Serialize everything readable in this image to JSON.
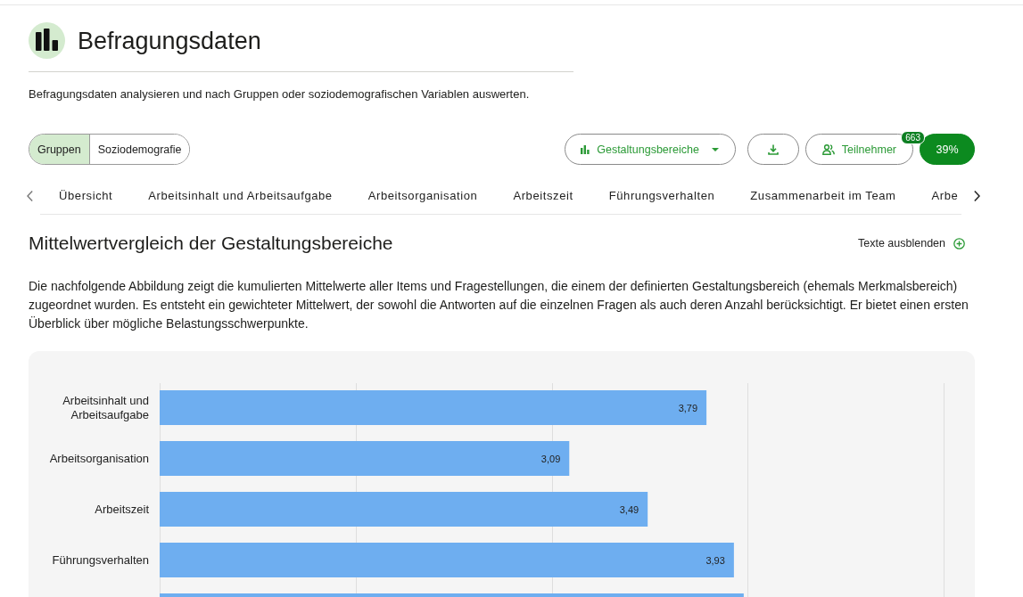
{
  "header": {
    "title": "Befragungsdaten",
    "subtitle": "Befragungsdaten analysieren und nach Gruppen oder soziodemografischen Variablen auswerten."
  },
  "view_toggle": [
    {
      "label": "Gruppen",
      "selected": true
    },
    {
      "label": "Soziodemografie",
      "selected": false
    }
  ],
  "toolbar": {
    "dropdown": {
      "label": "Gestaltungsbereiche"
    },
    "participants": {
      "label": "Teilnehmer",
      "count": "663"
    },
    "response_rate": "39%"
  },
  "tabs": [
    {
      "label": "Übersicht"
    },
    {
      "label": "Arbeitsinhalt und Arbeitsaufgabe"
    },
    {
      "label": "Arbeitsorganisation"
    },
    {
      "label": "Arbeitszeit"
    },
    {
      "label": "Führungsverhalten"
    },
    {
      "label": "Zusammenarbeit im Team"
    },
    {
      "label": "Arbe"
    }
  ],
  "section": {
    "title": "Mittelwertvergleich der Gestaltungsbereiche",
    "toggle_link": "Texte ausblenden",
    "description": "Die nachfolgende Abbildung zeigt die kumulierten Mittelwerte aller Items und Fragestellungen, die einem der definierten Gestaltungsbereich (ehemals Merkmalsbereich) zugeordnet wurden. Es entsteht ein gewichteter Mittelwert, der sowohl die Antworten auf die einzelnen Fragen als auch deren Anzahl berücksichtigt. Er bietet einen ersten Überblick über mögliche Belastungsschwerpunkte.",
    "chart_data": {
      "type": "bar",
      "orientation": "horizontal",
      "categories": [
        "Arbeitsinhalt und Arbeitsaufgabe",
        "Arbeitsorganisation",
        "Arbeitszeit",
        "Führungsverhalten",
        null
      ],
      "values": [
        3.79,
        3.09,
        3.49,
        3.93,
        3.98
      ],
      "xlim": [
        1,
        5
      ],
      "value_labels": [
        "3,79",
        "3,09",
        "3,49",
        "3,93",
        null
      ]
    }
  }
}
